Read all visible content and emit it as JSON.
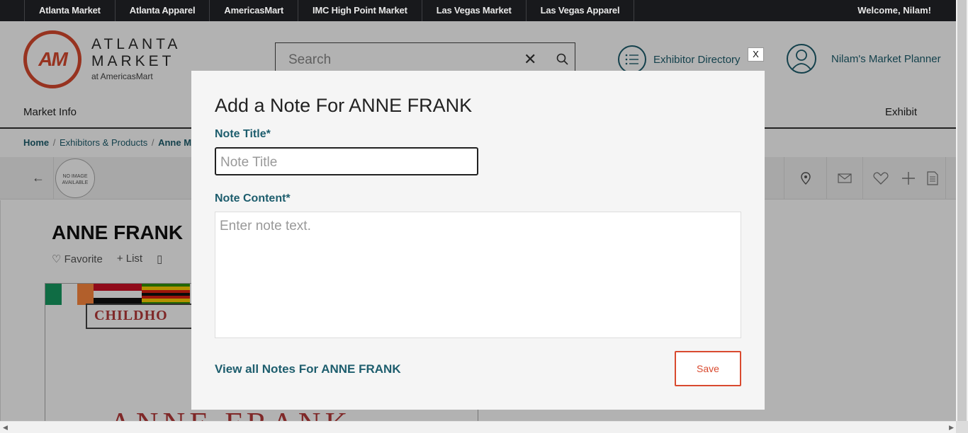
{
  "topbar": {
    "markets": [
      "Atlanta Market",
      "Atlanta Apparel",
      "AmericasMart",
      "IMC High Point Market",
      "Las Vegas Market",
      "Las Vegas Apparel"
    ],
    "welcome": "Welcome, Nilam!"
  },
  "header": {
    "logo": {
      "mark": "AM",
      "line1": "ATLANTA",
      "line2": "MARKET",
      "line3": "at AmericasMart"
    },
    "search_placeholder": "Search",
    "exhibitor_directory": "Exhibitor Directory",
    "market_planner": "Nilam's Market Planner",
    "nav_left": "Market Info",
    "nav_right": "Exhibit"
  },
  "breadcrumb": {
    "home": "Home",
    "exhibitors": "Exhibitors & Products",
    "current": "Anne Mc"
  },
  "exhibitor": {
    "no_image": "NO IMAGE AVAILABLE",
    "name": "ANNE FRANK",
    "favorite": "Favorite",
    "list": "List",
    "banner_childhood": "CHILDHO",
    "banner_title": "ANNE FRANK"
  },
  "modal": {
    "close": "X",
    "title": "Add a Note For ANNE FRANK",
    "note_title_label": "Note Title*",
    "note_title_placeholder": "Note Title",
    "note_content_label": "Note Content*",
    "note_content_placeholder": "Enter note text.",
    "view_all": "View all Notes For ANNE FRANK",
    "save": "Save"
  },
  "colors": {
    "accent": "#d94a2f",
    "teal": "#1d5d6d",
    "topbar": "#18191c"
  }
}
